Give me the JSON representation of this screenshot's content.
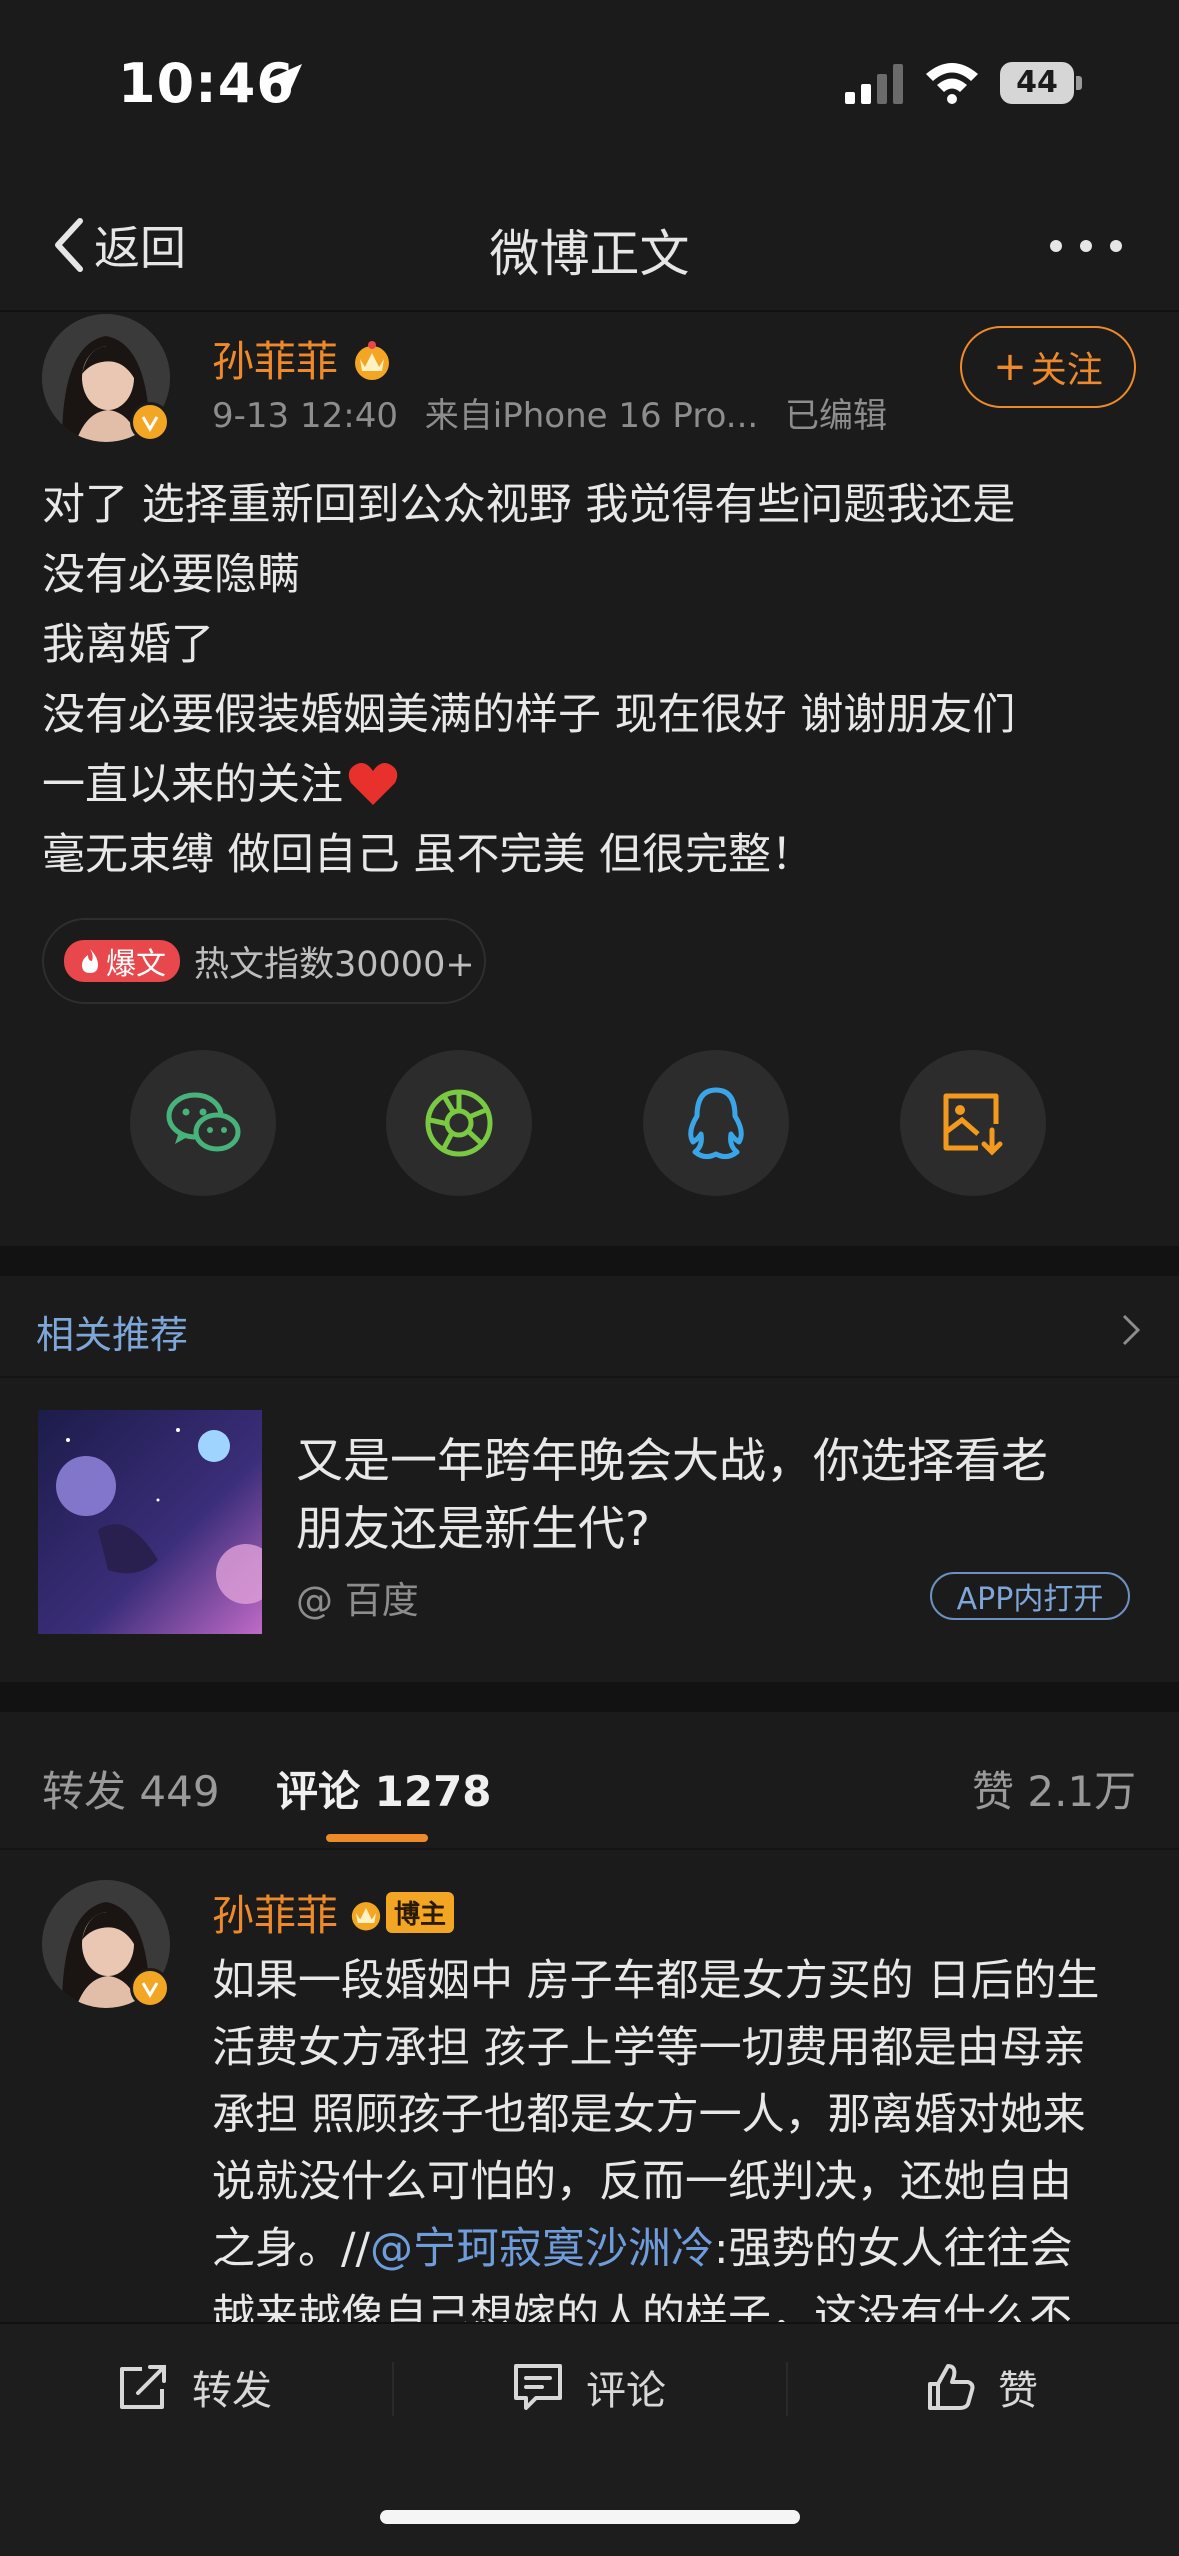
{
  "status_bar": {
    "time": "10:46",
    "battery": "44"
  },
  "nav": {
    "back_label": "返回",
    "title": "微博正文"
  },
  "post": {
    "author": "孙菲菲",
    "time": "9-13 12:40",
    "source": "来自iPhone 16 Pro...",
    "edited": "已编辑",
    "follow_label": "关注",
    "lines": [
      "对了 选择重新回到公众视野 我觉得有些问题我还是",
      "没有必要隐瞒",
      "我离婚了",
      "没有必要假装婚姻美满的样子 现在很好 谢谢朋友们",
      "一直以来的关注",
      "毫无束缚 做回自己 虽不完美 但很完整！"
    ],
    "hot_tag": "爆文",
    "hot_text": "热文指数30000+"
  },
  "share_buttons": [
    {
      "icon": "wechat-icon",
      "color": "#47b27a"
    },
    {
      "icon": "moments-icon",
      "color": "#7ac943"
    },
    {
      "icon": "qq-icon",
      "color": "#3aa6e8"
    },
    {
      "icon": "save-image-icon",
      "color": "#f39a1e"
    }
  ],
  "recommend": {
    "title": "相关推荐",
    "headline_lines": [
      "又是一年跨年晚会大战，你选择看老",
      "朋友还是新生代?"
    ],
    "source": "@ 百度",
    "open_label": "APP内打开"
  },
  "tabs": {
    "repost_label": "转发",
    "repost_count": "449",
    "comment_label": "评论",
    "comment_count": "1278",
    "like_label": "赞",
    "like_count": "2.1万"
  },
  "comment": {
    "author": "孙菲菲",
    "badge": "博主",
    "lines": [
      "如果一段婚姻中 房子车都是女方买的 日后的生",
      "活费女方承担  孩子上学等一切费用都是由母亲",
      "承担  照顾孩子也都是女方一人，那离婚对她来",
      "说就没什么可怕的，反而一纸判决，还她自由"
    ],
    "last_prefix": "之身。//",
    "mention": "@宁珂寂寞沙洲冷",
    "last_suffix": ":强势的女人往往会",
    "cut_line": "越来越像自己想嫁的人的样子，这没有什么不"
  },
  "bottom_bar": {
    "repost": "转发",
    "comment": "评论",
    "like": "赞"
  },
  "colors": {
    "accent": "#ef8a2b",
    "link": "#7fa6d8",
    "background": "#1b1b1b"
  }
}
